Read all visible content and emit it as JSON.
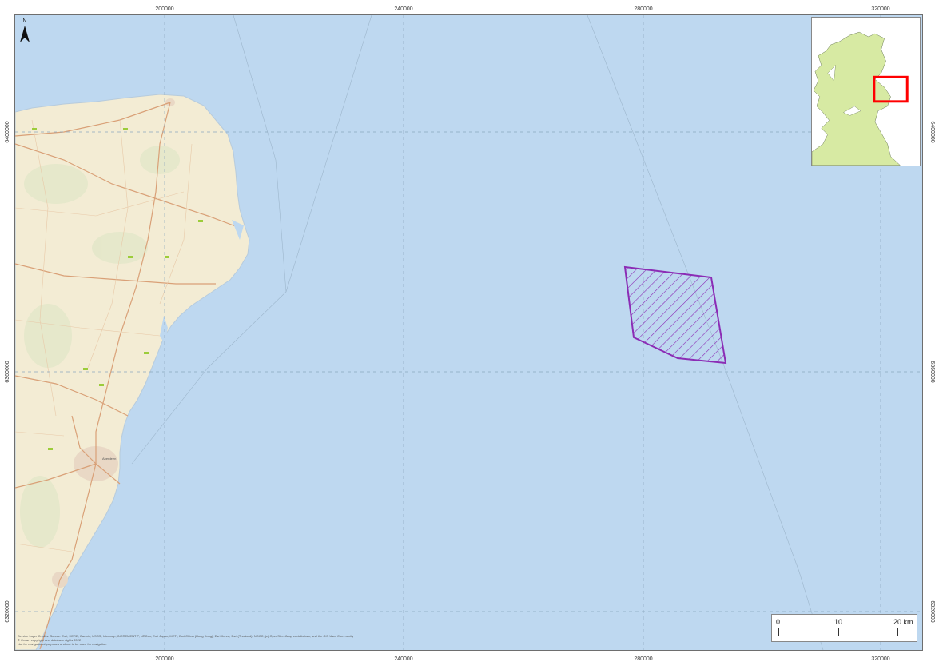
{
  "map": {
    "north_label": "N",
    "grid_x_labels": [
      "200000",
      "240000",
      "280000",
      "320000"
    ],
    "grid_y_labels": [
      "6400000",
      "6360000",
      "6320000"
    ],
    "scale_bar": {
      "labels": [
        "0",
        "10",
        "20 km"
      ]
    },
    "credits": [
      "Service Layer Credits: Source: Esri, HERE, Garmin, USGS, Intermap, INCREMENT P, NRCan, Esri Japan, METI, Esri China (Hong Kong), Esri Korea, Esri (Thailand), NGCC, (c) OpenStreetMap contributors, and the GIS User Community",
      "© Crown copyright and database rights 2022",
      "Not for navigational purposes and not to be used for navigation"
    ],
    "towns": [
      "Aberdeen"
    ],
    "colors": {
      "sea": "#bed8f0",
      "land": "#f3ecd4",
      "site_outline": "#8b2cb5",
      "inset_land": "#d7eaa3",
      "inset_locator": "#ff0000"
    },
    "icons": [
      "north-arrow-icon"
    ]
  }
}
